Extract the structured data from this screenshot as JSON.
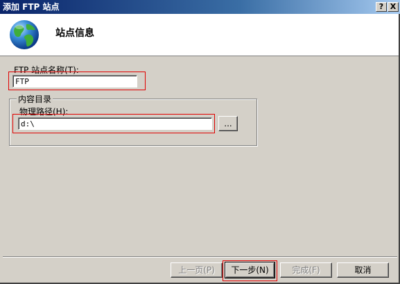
{
  "window": {
    "title": "添加 FTP 站点",
    "help_glyph": "?",
    "close_glyph": "X"
  },
  "header": {
    "title": "站点信息",
    "icon": "globe-icon"
  },
  "site_name": {
    "label": "FTP 站点名称(T):",
    "value": "FTP"
  },
  "content_dir": {
    "group_label": "内容目录",
    "path_label": "物理路径(H):",
    "path_value": "d:\\",
    "browse_label": "..."
  },
  "buttons": {
    "prev": "上一页(P)",
    "next": "下一步(N)",
    "finish": "完成(F)",
    "cancel": "取消"
  },
  "colors": {
    "highlight_box": "#e00000",
    "title_gradient_start": "#0a246a",
    "title_gradient_end": "#a6caf0"
  }
}
